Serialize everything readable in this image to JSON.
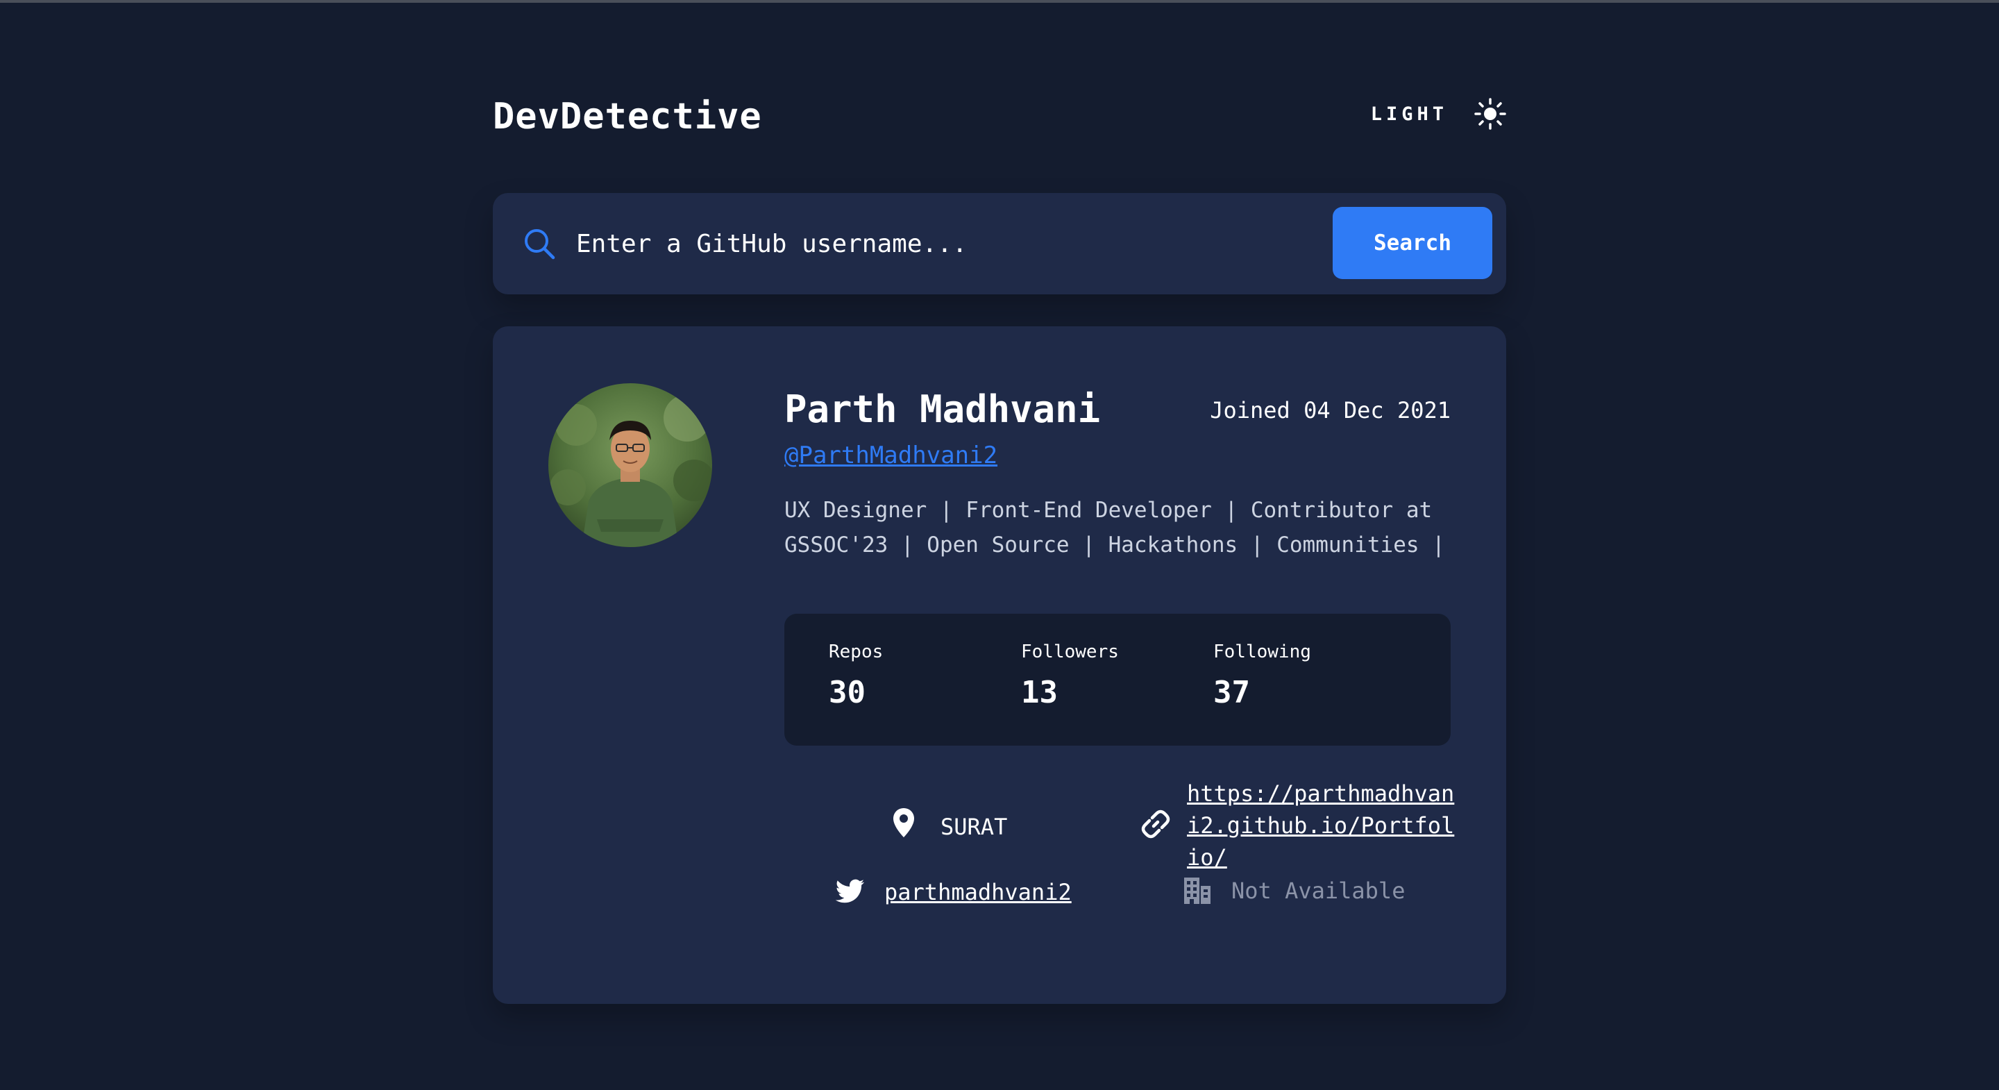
{
  "app": {
    "title": "DevDetective"
  },
  "theme_toggle": {
    "label": "LIGHT",
    "icon": "sun-icon"
  },
  "search": {
    "placeholder": "Enter a GitHub username...",
    "button_label": "Search",
    "icon": "search-icon"
  },
  "profile": {
    "name": "Parth Madhvani",
    "joined": "Joined 04 Dec 2021",
    "username": "@ParthMadhvani2",
    "bio": "UX Designer | Front-End Developer | Contributor at GSSOC'23 | Open Source | Hackathons | Communities |",
    "stats": [
      {
        "label": "Repos",
        "value": "30"
      },
      {
        "label": "Followers",
        "value": "13"
      },
      {
        "label": "Following",
        "value": "37"
      }
    ],
    "links": {
      "location": {
        "icon": "location-pin-icon",
        "text": "SURAT"
      },
      "website": {
        "icon": "link-icon",
        "text": "https://parthmadhvani2.github.io/Portfolio/"
      },
      "twitter": {
        "icon": "twitter-icon",
        "text": "parthmadhvani2"
      },
      "company": {
        "icon": "building-icon",
        "text": "Not Available"
      }
    }
  },
  "colors": {
    "background": "#141c2f",
    "card": "#1f2a48",
    "accent": "#2f7bf5",
    "muted_text": "#8b93a8"
  }
}
